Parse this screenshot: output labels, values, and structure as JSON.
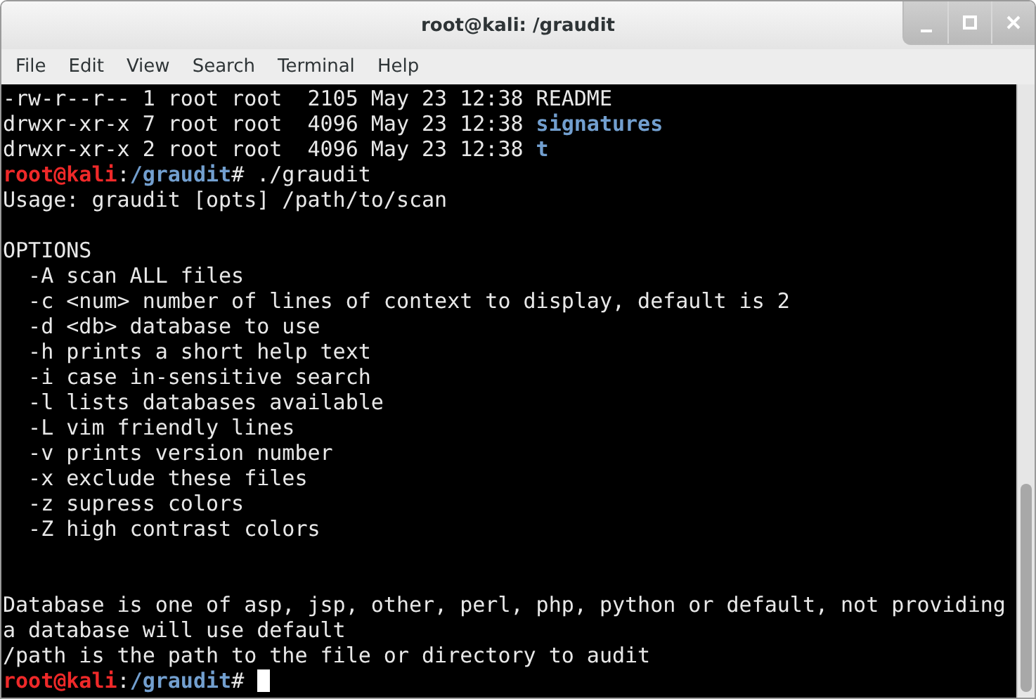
{
  "window": {
    "title": "root@kali: /graudit"
  },
  "menu": [
    "File",
    "Edit",
    "View",
    "Search",
    "Terminal",
    "Help"
  ],
  "terminal": {
    "cursor": true,
    "lines": [
      {
        "kind": "text",
        "segments": [
          {
            "kind": "plain",
            "text": "-rw-r--r-- 1 root root  2105 May 23 12:38 README"
          }
        ]
      },
      {
        "kind": "text",
        "segments": [
          {
            "kind": "plain",
            "text": "drwxr-xr-x 7 root root  4096 May 23 12:38 "
          },
          {
            "kind": "dir",
            "text": "signatures"
          }
        ]
      },
      {
        "kind": "text",
        "segments": [
          {
            "kind": "plain",
            "text": "drwxr-xr-x 2 root root  4096 May 23 12:38 "
          },
          {
            "kind": "dir",
            "text": "t"
          }
        ]
      },
      {
        "kind": "text",
        "segments": [
          {
            "kind": "user",
            "text": "root@kali"
          },
          {
            "kind": "plain",
            "text": ":"
          },
          {
            "kind": "path",
            "text": "/graudit"
          },
          {
            "kind": "plain",
            "text": "# ./graudit"
          }
        ]
      },
      {
        "kind": "text",
        "segments": [
          {
            "kind": "plain",
            "text": "Usage: graudit [opts] /path/to/scan"
          }
        ]
      },
      {
        "kind": "blank"
      },
      {
        "kind": "text",
        "segments": [
          {
            "kind": "plain",
            "text": "OPTIONS"
          }
        ]
      },
      {
        "kind": "text",
        "segments": [
          {
            "kind": "plain",
            "text": "  -A scan ALL files"
          }
        ]
      },
      {
        "kind": "text",
        "segments": [
          {
            "kind": "plain",
            "text": "  -c <num> number of lines of context to display, default is 2"
          }
        ]
      },
      {
        "kind": "text",
        "segments": [
          {
            "kind": "plain",
            "text": "  -d <db> database to use"
          }
        ]
      },
      {
        "kind": "text",
        "segments": [
          {
            "kind": "plain",
            "text": "  -h prints a short help text"
          }
        ]
      },
      {
        "kind": "text",
        "segments": [
          {
            "kind": "plain",
            "text": "  -i case in-sensitive search"
          }
        ]
      },
      {
        "kind": "text",
        "segments": [
          {
            "kind": "plain",
            "text": "  -l lists databases available"
          }
        ]
      },
      {
        "kind": "text",
        "segments": [
          {
            "kind": "plain",
            "text": "  -L vim friendly lines"
          }
        ]
      },
      {
        "kind": "text",
        "segments": [
          {
            "kind": "plain",
            "text": "  -v prints version number"
          }
        ]
      },
      {
        "kind": "text",
        "segments": [
          {
            "kind": "plain",
            "text": "  -x exclude these files"
          }
        ]
      },
      {
        "kind": "text",
        "segments": [
          {
            "kind": "plain",
            "text": "  -z supress colors"
          }
        ]
      },
      {
        "kind": "text",
        "segments": [
          {
            "kind": "plain",
            "text": "  -Z high contrast colors"
          }
        ]
      },
      {
        "kind": "blank"
      },
      {
        "kind": "blank"
      },
      {
        "kind": "text",
        "segments": [
          {
            "kind": "plain",
            "text": "Database is one of asp, jsp, other, perl, php, python or default, not providing"
          }
        ]
      },
      {
        "kind": "text",
        "segments": [
          {
            "kind": "plain",
            "text": "a database will use default"
          }
        ]
      },
      {
        "kind": "text",
        "segments": [
          {
            "kind": "plain",
            "text": "/path is the path to the file or directory to audit"
          }
        ]
      },
      {
        "kind": "text",
        "segments": [
          {
            "kind": "user",
            "text": "root@kali"
          },
          {
            "kind": "plain",
            "text": ":"
          },
          {
            "kind": "path",
            "text": "/graudit"
          },
          {
            "kind": "plain",
            "text": "# "
          }
        ]
      }
    ]
  }
}
